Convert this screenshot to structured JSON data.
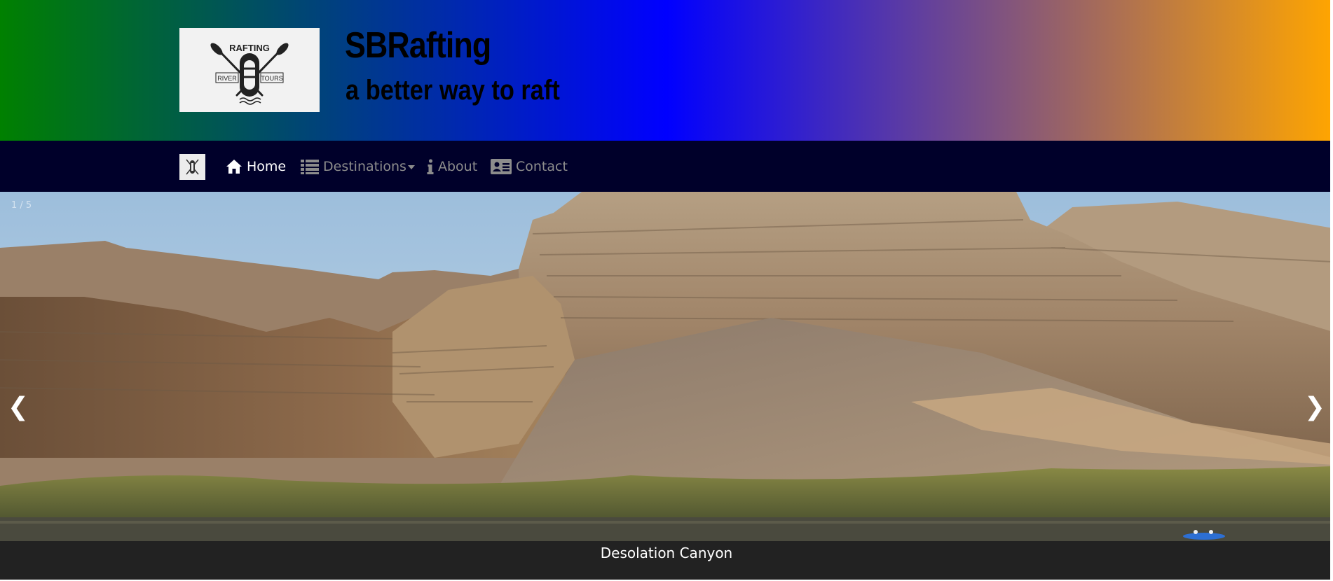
{
  "header": {
    "logo_text_top": "RAFTING",
    "logo_text_left": "RIVER",
    "logo_text_right": "TOURS",
    "title": "SBRafting",
    "tagline": "a better way to raft",
    "gradient": [
      "#008000",
      "#0000ff",
      "#ffa500"
    ]
  },
  "navbar": {
    "background": "#00002a",
    "brand_icon": "raft-logo-icon",
    "items": [
      {
        "label": "Home",
        "icon": "home-icon",
        "active": true
      },
      {
        "label": "Destinations",
        "icon": "list-icon",
        "dropdown": true
      },
      {
        "label": "About",
        "icon": "info-icon"
      },
      {
        "label": "Contact",
        "icon": "id-card-icon"
      }
    ]
  },
  "carousel": {
    "counter": "1 / 5",
    "prev_label": "❮",
    "next_label": "❯",
    "caption": "Desolation Canyon",
    "caption_background": "#222222"
  }
}
